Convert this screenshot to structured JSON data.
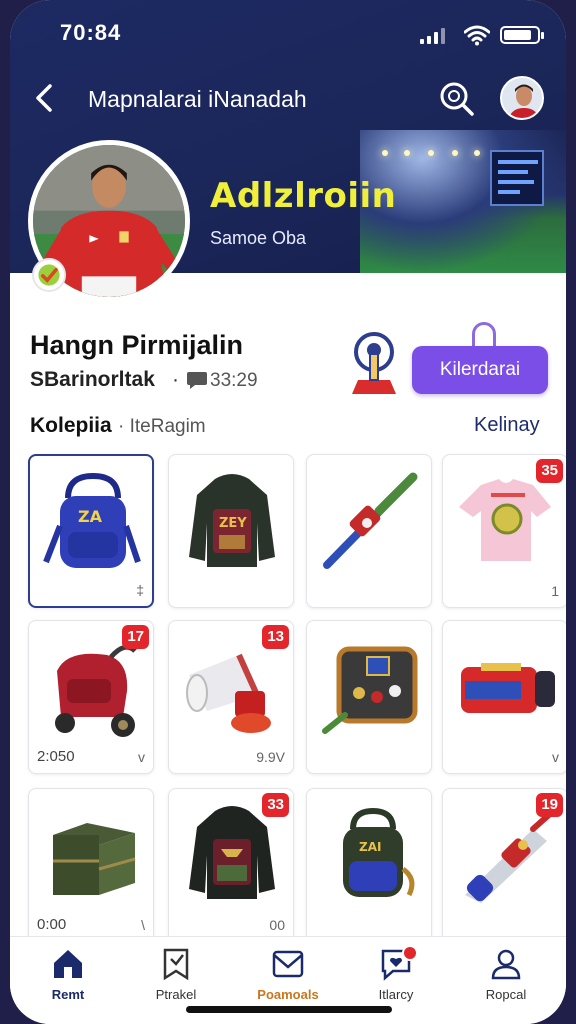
{
  "status_bar": {
    "time": "70:84",
    "battery_level": 0.85
  },
  "header": {
    "title": "Mapnalarai iNanadah",
    "team_name": "Adlzlroiin",
    "team_sub": "Samoe Oba"
  },
  "profile": {
    "name": "Hangn Pirmijalin",
    "handle": "SBarinorltak",
    "separator": "·",
    "count": "33:29",
    "follow_label": "Kilerdarai"
  },
  "collection": {
    "title": "Kolepiia",
    "subtitle": "· IteRagim",
    "link": "Kelinay"
  },
  "items": [
    {
      "icon": "blue-backpack-icon",
      "badge": "",
      "price": "",
      "meta": "‡"
    },
    {
      "icon": "dark-jacket-icon",
      "badge": "",
      "price": "",
      "meta": ""
    },
    {
      "icon": "rocket-bat-icon",
      "badge": "",
      "price": "",
      "meta": ""
    },
    {
      "icon": "jersey-shirt-icon",
      "badge": "35",
      "price": "",
      "meta": "1"
    },
    {
      "icon": "red-stroller-icon",
      "badge": "17",
      "price": "2:050",
      "meta": "v"
    },
    {
      "icon": "horn-icon",
      "badge": "13",
      "price": "",
      "meta": "9.9V"
    },
    {
      "icon": "gadget-case-icon",
      "badge": "",
      "price": "",
      "meta": ""
    },
    {
      "icon": "red-bag-icon",
      "badge": "",
      "price": "",
      "meta": "v"
    },
    {
      "icon": "green-chest-icon",
      "badge": "",
      "price": "0:00",
      "meta": "\\"
    },
    {
      "icon": "black-jacket-icon",
      "badge": "33",
      "price": "",
      "meta": "00"
    },
    {
      "icon": "green-backpack-icon",
      "badge": "",
      "price": "",
      "meta": ""
    },
    {
      "icon": "blaster-icon",
      "badge": "19",
      "price": "",
      "meta": ""
    }
  ],
  "bottom_nav": [
    {
      "label": "Remt",
      "icon": "home-icon"
    },
    {
      "label": "Ptrakel",
      "icon": "bookmark-icon"
    },
    {
      "label": "Poamoals",
      "icon": "mail-icon"
    },
    {
      "label": "Itlarcy",
      "icon": "chat-heart-icon"
    },
    {
      "label": "Ropcal",
      "icon": "person-icon"
    }
  ],
  "colors": {
    "header_bg": "#1b2659",
    "accent_yellow": "#f0f03a",
    "follow_button": "#7b4ee8",
    "badge_red": "#e2262b",
    "active_orange": "#c9761c"
  }
}
